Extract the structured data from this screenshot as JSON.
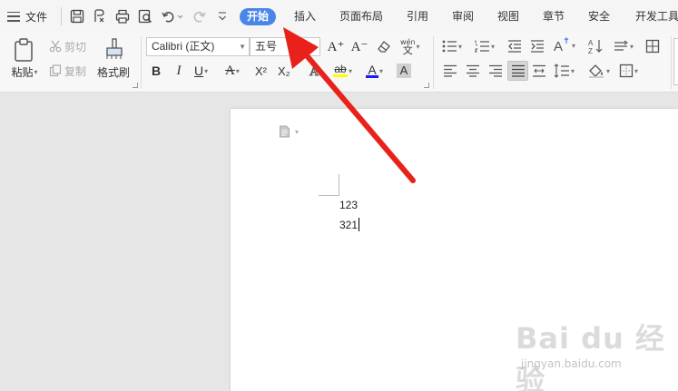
{
  "menubar": {
    "file_label": "文件",
    "tabs": [
      {
        "label": "开始",
        "active": true
      },
      {
        "label": "插入",
        "active": false
      },
      {
        "label": "页面布局",
        "active": false
      },
      {
        "label": "引用",
        "active": false
      },
      {
        "label": "审阅",
        "active": false
      },
      {
        "label": "视图",
        "active": false
      },
      {
        "label": "章节",
        "active": false
      },
      {
        "label": "安全",
        "active": false
      },
      {
        "label": "开发工具",
        "active": false
      }
    ]
  },
  "ribbon": {
    "paste_label": "粘贴",
    "cut_label": "剪切",
    "copy_label": "复制",
    "format_painter_label": "格式刷",
    "font_name": "Calibri (正文)",
    "font_size": "五号",
    "bold": "B",
    "italic": "I",
    "underline": "U",
    "strikethrough_glyph": "A",
    "superscript": "X²",
    "subscript": "X₂",
    "highlight_glyph": "ab",
    "font_color_glyph": "A",
    "char_shading_glyph": "A",
    "grow_font": "A⁺",
    "shrink_font": "A⁻",
    "phonetic_glyph": "wén",
    "font_color_hex": "#1a1aff",
    "highlight_hex": "#ffff00"
  },
  "document": {
    "lines": [
      "123",
      "321"
    ]
  },
  "annotation": {
    "arrow_color": "#e8221b"
  },
  "watermark": {
    "main": "Bai du 经验",
    "sub": "jingyan.baidu.com"
  }
}
